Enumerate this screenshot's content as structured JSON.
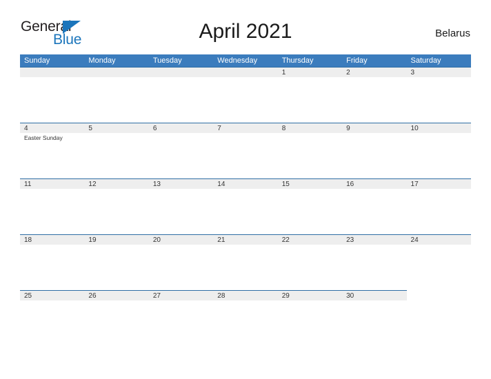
{
  "brand": {
    "name_part1": "General",
    "name_part2": "Blue",
    "triangle_color": "#1b75bb"
  },
  "header": {
    "title": "April 2021",
    "country": "Belarus"
  },
  "calendar": {
    "header_bg": "#3b7cbd",
    "band_bg": "#eeeeee",
    "band_border": "#2e6da4",
    "weekdays": [
      "Sunday",
      "Monday",
      "Tuesday",
      "Wednesday",
      "Thursday",
      "Friday",
      "Saturday"
    ],
    "weeks": [
      [
        {
          "day": "",
          "events": [],
          "blank": true
        },
        {
          "day": "",
          "events": [],
          "blank": true
        },
        {
          "day": "",
          "events": [],
          "blank": true
        },
        {
          "day": "",
          "events": [],
          "blank": true
        },
        {
          "day": "1",
          "events": []
        },
        {
          "day": "2",
          "events": []
        },
        {
          "day": "3",
          "events": []
        }
      ],
      [
        {
          "day": "4",
          "events": [
            "Easter Sunday"
          ]
        },
        {
          "day": "5",
          "events": []
        },
        {
          "day": "6",
          "events": []
        },
        {
          "day": "7",
          "events": []
        },
        {
          "day": "8",
          "events": []
        },
        {
          "day": "9",
          "events": []
        },
        {
          "day": "10",
          "events": []
        }
      ],
      [
        {
          "day": "11",
          "events": []
        },
        {
          "day": "12",
          "events": []
        },
        {
          "day": "13",
          "events": []
        },
        {
          "day": "14",
          "events": []
        },
        {
          "day": "15",
          "events": []
        },
        {
          "day": "16",
          "events": []
        },
        {
          "day": "17",
          "events": []
        }
      ],
      [
        {
          "day": "18",
          "events": []
        },
        {
          "day": "19",
          "events": []
        },
        {
          "day": "20",
          "events": []
        },
        {
          "day": "21",
          "events": []
        },
        {
          "day": "22",
          "events": []
        },
        {
          "day": "23",
          "events": []
        },
        {
          "day": "24",
          "events": []
        }
      ],
      [
        {
          "day": "25",
          "events": []
        },
        {
          "day": "26",
          "events": []
        },
        {
          "day": "27",
          "events": []
        },
        {
          "day": "28",
          "events": []
        },
        {
          "day": "29",
          "events": []
        },
        {
          "day": "30",
          "events": []
        },
        {
          "day": "",
          "events": [],
          "empty_tail": true
        }
      ]
    ]
  }
}
